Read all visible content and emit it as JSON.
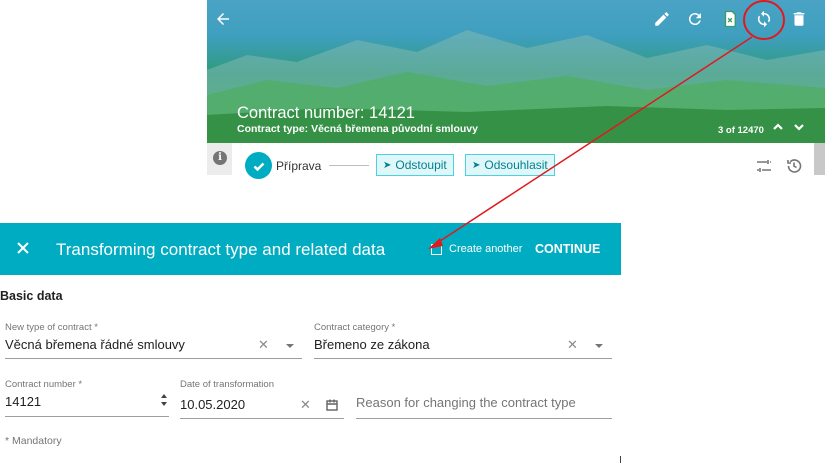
{
  "header": {
    "contract_number": "Contract number: 14121",
    "contract_type": "Contract type: Věcná břemena původní smlouvy",
    "pager": "3 of 12470",
    "icons": [
      "back-arrow-icon",
      "pencil-icon",
      "refresh-icon",
      "delete-file-icon",
      "transform-icon",
      "trash-icon",
      "chevron-up-icon",
      "chevron-down-icon"
    ]
  },
  "workflow": {
    "step_label": "Příprava",
    "buttons": [
      "Odstoupit",
      "Odsouhlasit"
    ]
  },
  "dialog": {
    "title": "Transforming contract type and related data",
    "create_another": "Create another",
    "continue": "CONTINUE",
    "section_title": "Basic data",
    "fields": {
      "new_type_label": "New type of contract *",
      "new_type_value": "Věcná břemena řádné smlouvy",
      "category_label": "Contract category *",
      "category_value": "Břemeno ze zákona",
      "number_label": "Contract number *",
      "number_value": "14121",
      "date_label": "Date of transformation",
      "date_value": "10.05.2020",
      "reason_placeholder": "Reason for changing the contract type"
    },
    "mandatory_note": "* Mandatory"
  },
  "colors": {
    "accent": "#00acc1",
    "annotation": "#e0191f"
  }
}
